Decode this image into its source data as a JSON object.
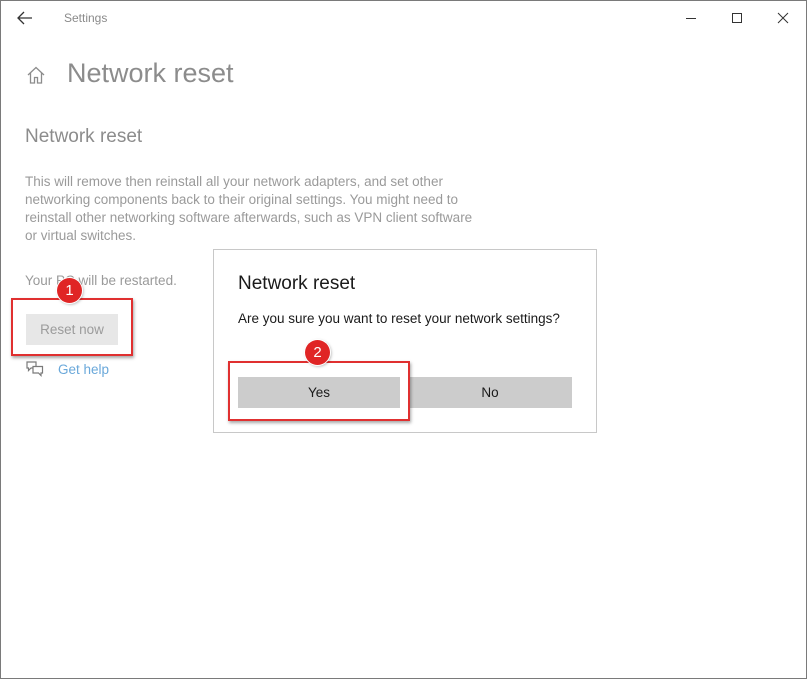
{
  "window": {
    "title": "Settings"
  },
  "page": {
    "title": "Network reset",
    "section_title": "Network reset",
    "description": "This will remove then reinstall all your network adapters, and set other networking components back to their original settings. You might need to reinstall other networking software afterwards, such as VPN client software or virtual switches.",
    "restart_note": "Your PC will be restarted.",
    "reset_button": "Reset now",
    "get_help": "Get help"
  },
  "dialog": {
    "title": "Network reset",
    "message": "Are you sure you want to reset your network settings?",
    "yes_label": "Yes",
    "no_label": "No"
  },
  "annotations": {
    "badge_1": "1",
    "badge_2": "2"
  },
  "icons": {
    "back": "back-arrow-icon",
    "home": "home-icon",
    "minimize": "minimize-icon",
    "maximize": "maximize-icon",
    "close": "close-icon",
    "get_help": "chat-help-icon"
  },
  "colors": {
    "annotation": "#e03030",
    "link": "#6aa8da",
    "dialog_button": "#cccccc"
  }
}
